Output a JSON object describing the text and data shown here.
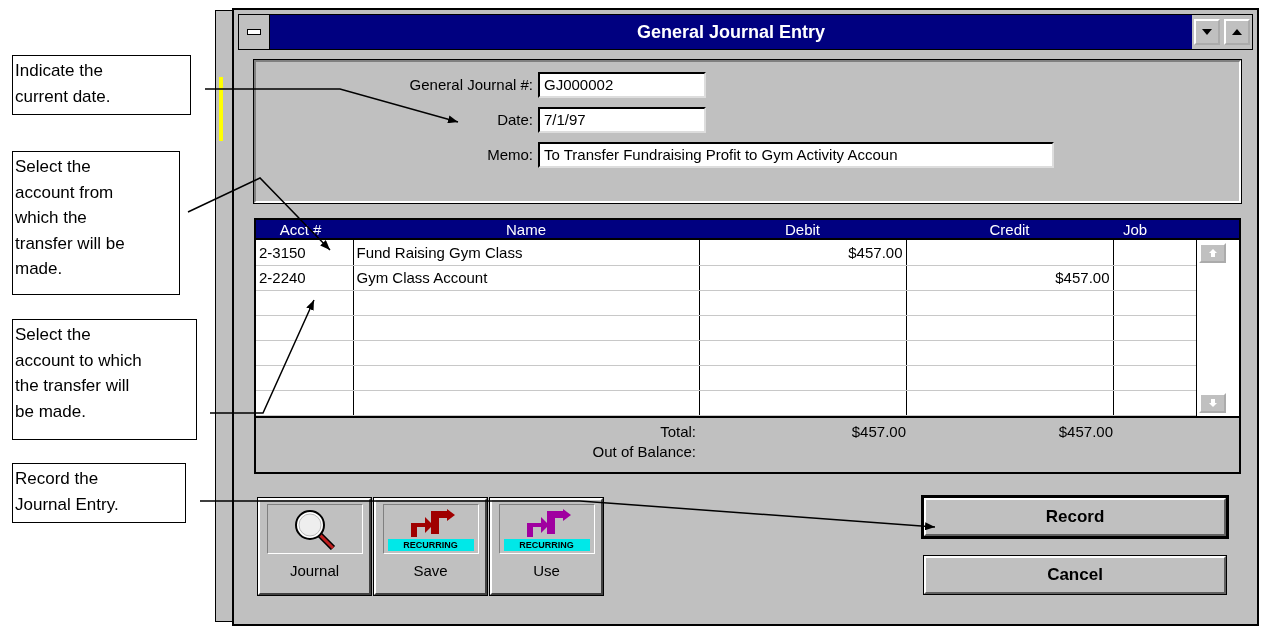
{
  "callouts": [
    {
      "text": "Indicate the\ncurrent date."
    },
    {
      "text": "Select the\naccount from\nwhich the\ntransfer will be\nmade."
    },
    {
      "text": "Select the\naccount to which\nthe transfer will\nbe made."
    },
    {
      "text": "Record the\nJournal Entry."
    }
  ],
  "window": {
    "title": "General Journal Entry"
  },
  "header_fields": [
    {
      "label": "General Journal #:",
      "value": "GJ000002",
      "kind": "short"
    },
    {
      "label": "Date:",
      "value": "7/1/97",
      "kind": "short"
    },
    {
      "label": "Memo:",
      "value": "To Transfer Fundraising Profit to Gym Activity Accoun",
      "kind": "long"
    }
  ],
  "table": {
    "columns": [
      "Acct #",
      "Name",
      "Debit",
      "Credit",
      "Job"
    ],
    "rows": [
      {
        "acct": "2-3150",
        "name": "Fund Raising Gym Class",
        "debit": "$457.00"
      },
      {
        "acct": "2-2240",
        "name": "Gym Class Account",
        "credit": "$457.00"
      }
    ]
  },
  "totals": [
    {
      "label": "Total:",
      "debit": "$457.00",
      "credit": "$457.00"
    },
    {
      "label": "Out of Balance:"
    }
  ],
  "tool_buttons": [
    {
      "label": "Journal",
      "kind": "journal"
    },
    {
      "label": "Save",
      "kind": "recurring",
      "badge": "RECURRING",
      "color": "#a00000"
    },
    {
      "label": "Use",
      "kind": "recurring",
      "badge": "RECURRING",
      "color": "#a000a0"
    }
  ],
  "actions": [
    {
      "label": "Record",
      "default": true
    },
    {
      "label": "Cancel",
      "default": false
    }
  ]
}
